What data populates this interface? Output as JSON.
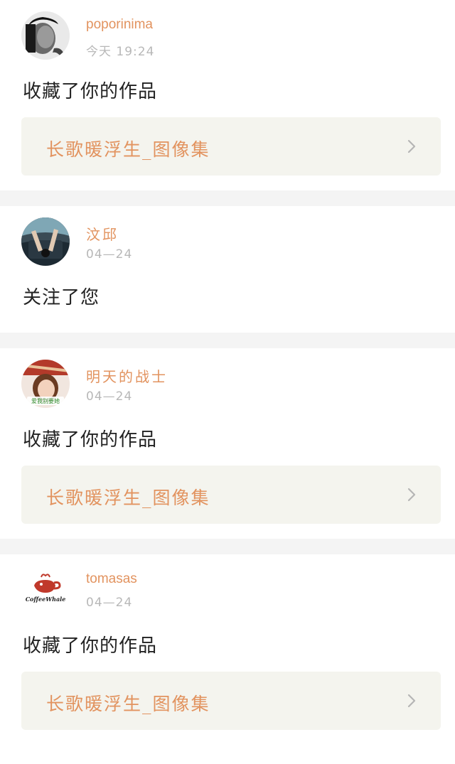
{
  "notifications": [
    {
      "username": "poporinima",
      "time": "今天  19:24",
      "action": "收藏了你的作品",
      "work_title": "长歌暖浮生_图像集",
      "avatar": "man-portrait-avatar"
    },
    {
      "username": "汶邱",
      "time": "04—24",
      "action": "关注了您",
      "avatar": "car-interior-avatar"
    },
    {
      "username": "明天的战士",
      "time": "04—24",
      "action": "收藏了你的作品",
      "work_title": "长歌暖浮生_图像集",
      "avatar": "girl-photo-avatar",
      "avatar_text": "爱我别要她"
    },
    {
      "username": "tomasas",
      "time": "04—24",
      "action": "收藏了你的作品",
      "work_title": "长歌暖浮生_图像集",
      "avatar": "coffee-whale-logo-avatar",
      "avatar_text": "CoffeeWhale"
    }
  ],
  "colors": {
    "accent": "#e2935f",
    "text": "#222222",
    "muted": "#b8b8b8",
    "work_bg": "#f4f4ee",
    "divider": "#f4f4f4"
  }
}
